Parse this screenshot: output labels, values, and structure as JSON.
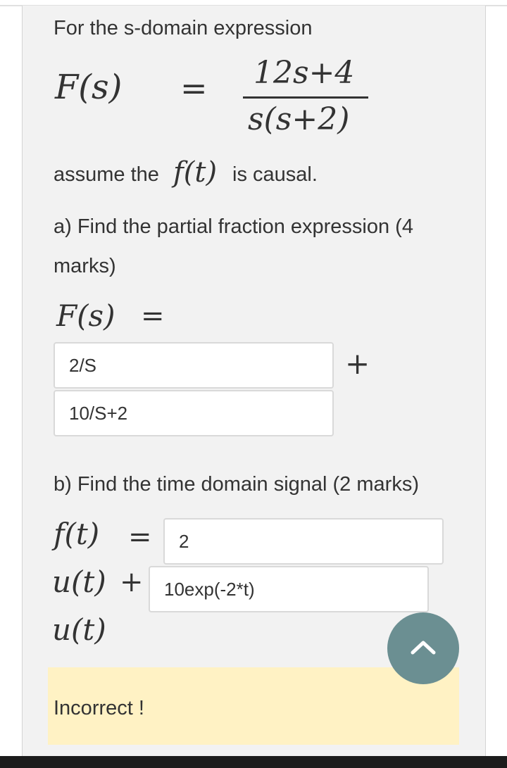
{
  "question": {
    "intro": "For the s-domain expression",
    "fs_lhs": "F(s)",
    "equals": "=",
    "numerator": "12s+4",
    "denominator": "s(s+2)",
    "assume_prefix": "assume the",
    "assume_ft": "f(t)",
    "assume_suffix": "is causal."
  },
  "part_a": {
    "prompt_line1": "a) Find the partial fraction  expression (4",
    "prompt_line2": "marks)",
    "fs_lhs": "F(s)",
    "equals": "=",
    "input1_value": "2/S",
    "plus": "+",
    "input2_value": "10/S+2"
  },
  "part_b": {
    "prompt": "b) Find the time domain signal (2 marks)",
    "ft_lhs": "f(t)",
    "equals": "=",
    "input1_value": "2",
    "ut1": "u(t)",
    "plus": "+",
    "input2_value": "10exp(-2*t)",
    "ut2": "u(t)"
  },
  "feedback": {
    "text": "Incorrect !"
  },
  "fab": {
    "icon": "chevron-up-icon"
  },
  "colors": {
    "card_bg": "#f2f2f2",
    "feedback_bg": "#fff2c4",
    "fab_bg": "#6b8f92",
    "text": "#333333"
  }
}
